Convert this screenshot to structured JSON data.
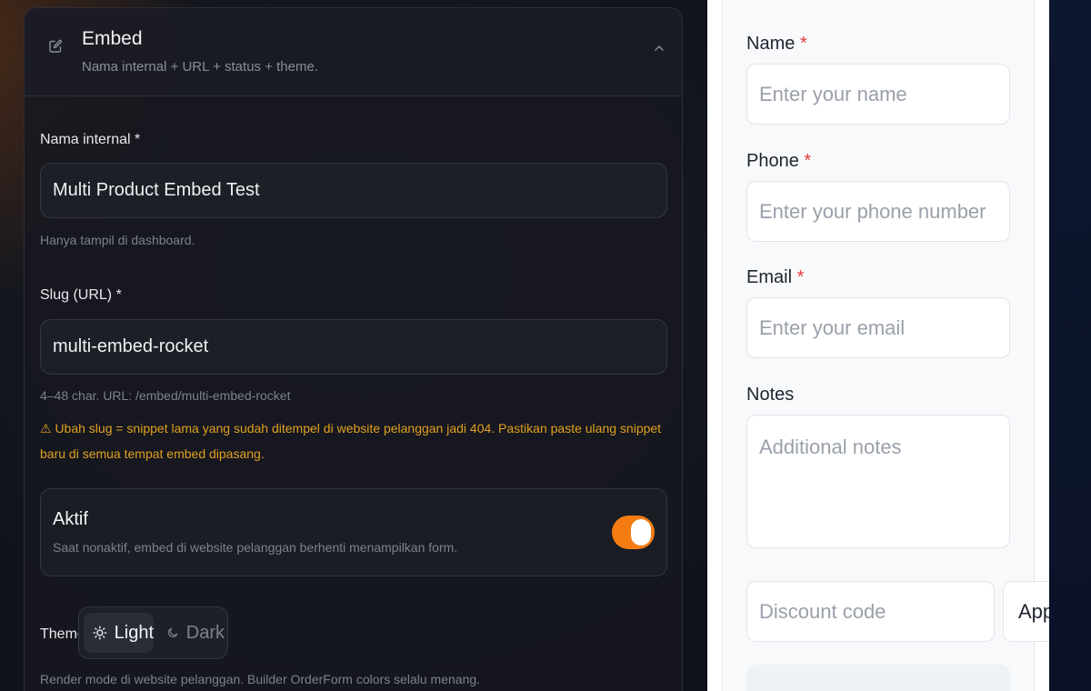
{
  "editor": {
    "section": {
      "title": "Embed",
      "subtitle": "Nama internal + URL + status + theme."
    },
    "internal_name": {
      "label": "Nama internal *",
      "value": "Multi Product Embed Test",
      "help": "Hanya tampil di dashboard."
    },
    "slug": {
      "label": "Slug (URL) *",
      "value": "multi-embed-rocket",
      "help": "4–48 char. URL: /embed/multi-embed-rocket",
      "warning": "⚠ Ubah slug = snippet lama yang sudah ditempel di website pelanggan jadi 404. Pastikan paste ulang snippet baru di semua tempat embed dipasang."
    },
    "active": {
      "title": "Aktif",
      "description": "Saat nonaktif, embed di website pelanggan berhenti menampilkan form.",
      "enabled": true,
      "color": "#f47c12"
    },
    "theme": {
      "label": "Theme",
      "options": [
        "Light",
        "Dark"
      ],
      "selected": "Light",
      "help": "Render mode di website pelanggan. Builder OrderForm colors selalu menang."
    }
  },
  "preview": {
    "fields": [
      {
        "label": "Name",
        "required": "*",
        "placeholder": "Enter your name"
      },
      {
        "label": "Phone",
        "required": "*",
        "placeholder": "Enter your phone number"
      },
      {
        "label": "Email",
        "required": "*",
        "placeholder": "Enter your email"
      }
    ],
    "notes": {
      "label": "Notes",
      "placeholder": "Additional notes"
    },
    "discount": {
      "placeholder": "Discount code",
      "apply_label": "App"
    }
  }
}
